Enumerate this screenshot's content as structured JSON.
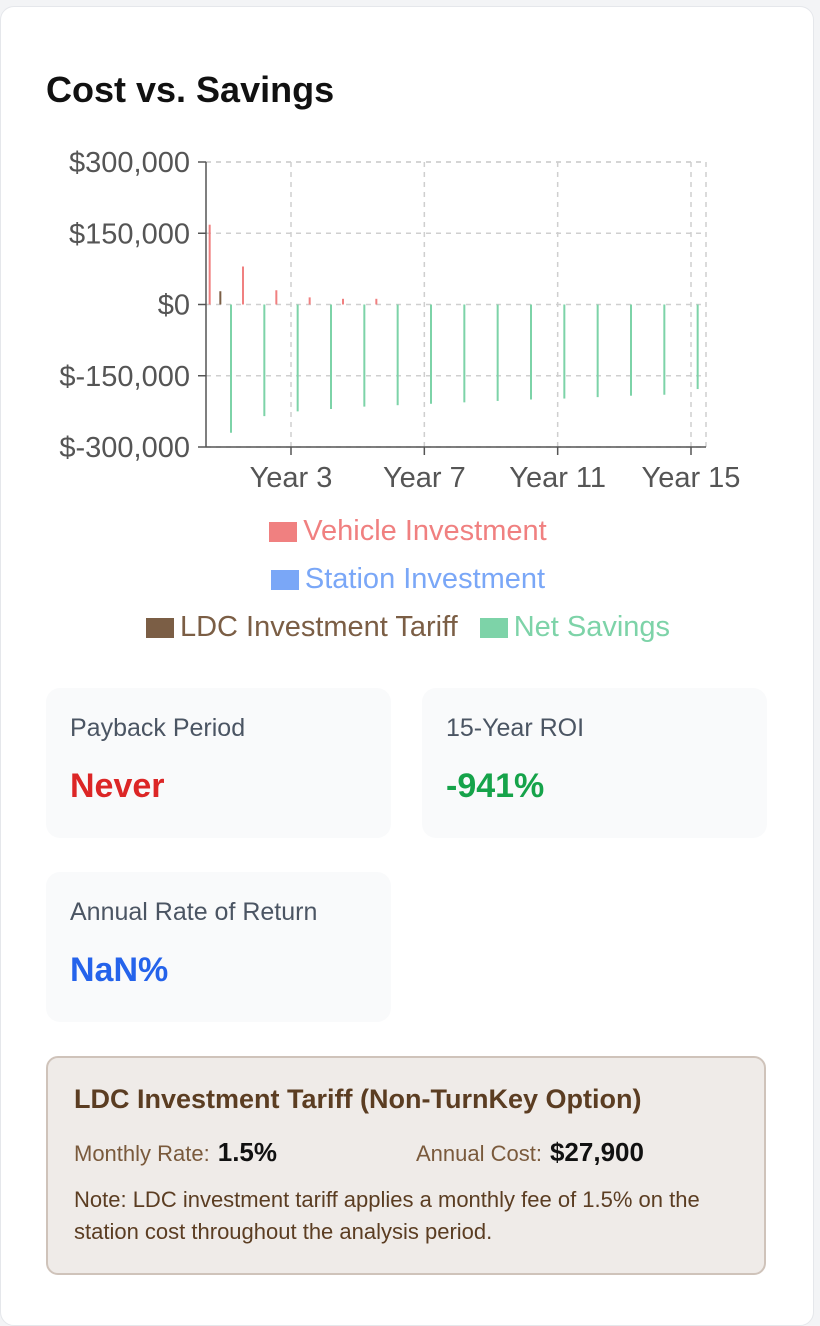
{
  "card": {
    "title": "Cost vs. Savings"
  },
  "chart_data": {
    "type": "bar",
    "title": "Cost vs. Savings",
    "years": [
      1,
      2,
      3,
      4,
      5,
      6,
      7,
      8,
      9,
      10,
      11,
      12,
      13,
      14,
      15
    ],
    "x_tick_labels": [
      "Year 3",
      "Year 7",
      "Year 11",
      "Year 15"
    ],
    "y_tick_labels": [
      "$300,000",
      "$150,000",
      "$0",
      "$-150,000",
      "$-300,000"
    ],
    "ylim": [
      -300000,
      300000
    ],
    "grid": true,
    "legend_position": "bottom",
    "series": [
      {
        "name": "Vehicle Investment",
        "color": "#f08080",
        "values": [
          168000,
          80000,
          30000,
          15000,
          12000,
          12000,
          0,
          0,
          0,
          0,
          0,
          0,
          0,
          0,
          0
        ]
      },
      {
        "name": "Station Investment",
        "color": "#7aa7f7",
        "values": [
          0,
          0,
          0,
          0,
          0,
          0,
          0,
          0,
          0,
          0,
          0,
          0,
          0,
          0,
          0
        ]
      },
      {
        "name": "LDC Investment Tariff",
        "color": "#7b5e45",
        "values": [
          27900,
          0,
          0,
          0,
          0,
          0,
          0,
          0,
          0,
          0,
          0,
          0,
          0,
          0,
          0
        ]
      },
      {
        "name": "Net Savings",
        "color": "#7dd3a8",
        "values": [
          -270000,
          -235000,
          -225000,
          -220000,
          -215000,
          -212000,
          -209000,
          -206000,
          -203000,
          -200000,
          -198000,
          -195000,
          -192000,
          -190000,
          -178000
        ]
      }
    ]
  },
  "legend": {
    "row1": "Vehicle Investment",
    "row2": "Station Investment",
    "row3a": "LDC Investment Tariff",
    "row3b": "Net Savings"
  },
  "stats": {
    "payback_label": "Payback Period",
    "payback_value": "Never",
    "roi_label": "15-Year ROI",
    "roi_value": "-941%",
    "annual_label": "Annual Rate of Return",
    "annual_value": "NaN%"
  },
  "ldc": {
    "heading": "LDC Investment Tariff (Non-TurnKey Option)",
    "monthly_rate_label": "Monthly Rate:",
    "monthly_rate_value": "1.5%",
    "annual_cost_label": "Annual Cost:",
    "annual_cost_value": "$27,900",
    "note": "Note: LDC investment tariff applies a monthly fee of 1.5% on the station cost throughout the analysis period."
  },
  "colors": {
    "negative": "#dc2626",
    "positive": "#16a34a",
    "neutral": "#2563eb"
  }
}
